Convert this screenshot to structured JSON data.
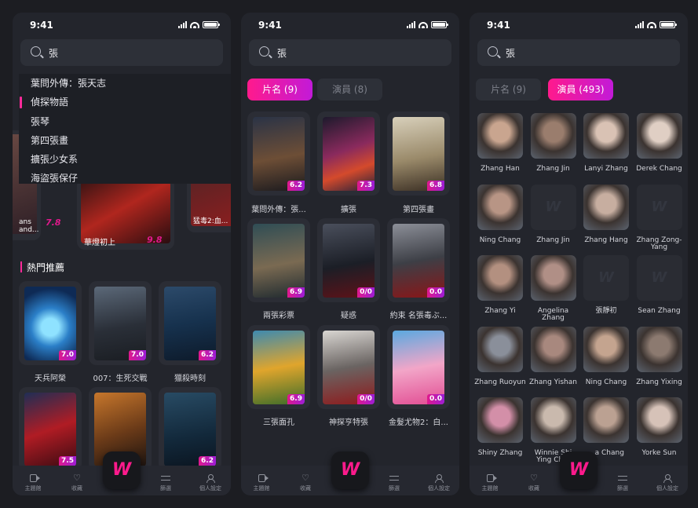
{
  "status": {
    "time": "9:41"
  },
  "colors": {
    "accent": "#ff1a8c",
    "accent2": "#c21ad8",
    "bg": "#23252c"
  },
  "brand": {
    "logo_text": "W"
  },
  "nav": [
    "主題館",
    "收藏",
    "篩選",
    "個人設定"
  ],
  "screen1": {
    "query": "張",
    "suggestions": [
      "葉問外傳：張天志",
      "偵探物語",
      "張琴",
      "第四張畫",
      "擴張少女系",
      "海盜張保仔"
    ],
    "peek": [
      {
        "title": "ans and...",
        "rating": "7.8"
      },
      {
        "title": "華燈初上",
        "rating": "9.8"
      },
      {
        "title": "猛毒2:血...",
        "rating": ""
      }
    ],
    "section_title": "熱門推薦",
    "movies": [
      {
        "title": "天兵阿榮",
        "rating": "7.0"
      },
      {
        "title": "007：生死交戰",
        "rating": "7.0"
      },
      {
        "title": "獵殺時刻",
        "rating": "6.2"
      },
      {
        "title": "",
        "rating": "7.5"
      },
      {
        "title": "",
        "rating": ""
      },
      {
        "title": "",
        "rating": "6.2"
      }
    ]
  },
  "screen2": {
    "query": "張",
    "tab_movie": "片名 (9)",
    "tab_actor": "演員 (8)",
    "movies": [
      {
        "title": "葉問外傳：張...",
        "rating": "6.2"
      },
      {
        "title": "擴張",
        "rating": "7.3"
      },
      {
        "title": "第四張畫",
        "rating": "6.8"
      },
      {
        "title": "兩張彩票",
        "rating": "6.9"
      },
      {
        "title": "疑惑",
        "rating": "0/0"
      },
      {
        "title": "約束 名張毒ぶ...",
        "rating": "0.0"
      },
      {
        "title": "三張面孔",
        "rating": "6.9"
      },
      {
        "title": "神探亨特張",
        "rating": "0/0"
      },
      {
        "title": "金髮尤物2：白...",
        "rating": "0.0"
      }
    ]
  },
  "screen3": {
    "query": "張",
    "tab_movie": "片名 (9)",
    "tab_actor": "演員 (493)",
    "actors": [
      "Zhang Han",
      "Zhang Jin",
      "Lanyi Zhang",
      "Derek Chang",
      "Ning Chang",
      "Zhang Jin",
      "Zhang Hang",
      "Zhang Zong-Yang",
      "Zhang Yi",
      "Angelina Zhang",
      "張靜初",
      "Sean Zhang",
      "Zhang Ruoyun",
      "Zhang Yishan",
      "Ning Chang",
      "Zhang Yixing",
      "Shiny Zhang",
      "Winnie Shi Ying Ch...",
      "...a Chang",
      "Yorke Sun"
    ]
  }
}
